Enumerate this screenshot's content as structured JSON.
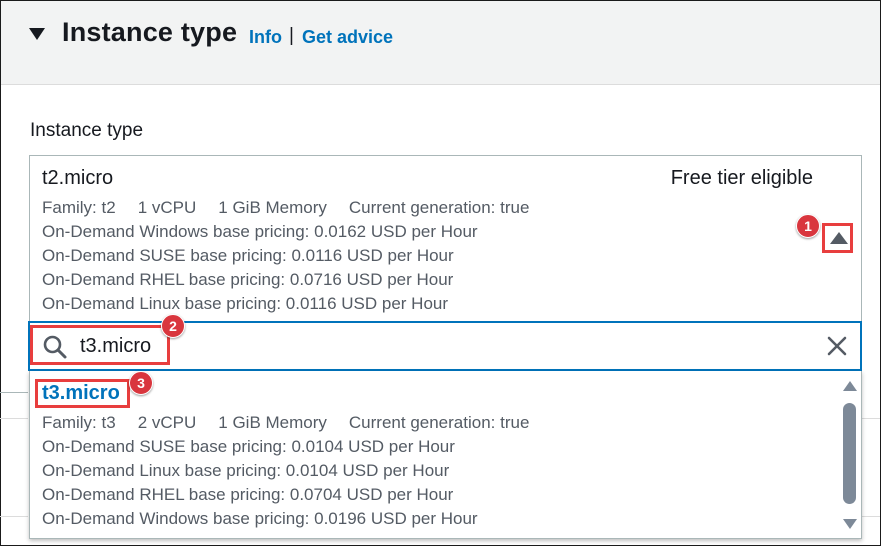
{
  "header": {
    "title": "Instance type",
    "info_link": "Info",
    "separator": "|",
    "advice_link": "Get advice"
  },
  "field": {
    "label": "Instance type"
  },
  "selected": {
    "name": "t2.micro",
    "badge": "Free tier eligible",
    "family": "Family: t2",
    "vcpu": "1 vCPU",
    "memory": "1 GiB Memory",
    "generation": "Current generation: true",
    "pricing": [
      "On-Demand Windows base pricing: 0.0162 USD per Hour",
      "On-Demand SUSE base pricing: 0.0116 USD per Hour",
      "On-Demand RHEL base pricing: 0.0716 USD per Hour",
      "On-Demand Linux base pricing: 0.0116 USD per Hour"
    ]
  },
  "search": {
    "value": "t3.micro"
  },
  "option": {
    "name": "t3.micro",
    "family": "Family: t3",
    "vcpu": "2 vCPU",
    "memory": "1 GiB Memory",
    "generation": "Current generation: true",
    "pricing": [
      "On-Demand SUSE base pricing: 0.0104 USD per Hour",
      "On-Demand Linux base pricing: 0.0104 USD per Hour",
      "On-Demand RHEL base pricing: 0.0704 USD per Hour",
      "On-Demand Windows base pricing: 0.0196 USD per Hour"
    ]
  },
  "callouts": [
    "1",
    "2",
    "3"
  ],
  "colors": {
    "link": "#0073bb",
    "callout": "#d9363e",
    "focus": "#0073bb"
  }
}
